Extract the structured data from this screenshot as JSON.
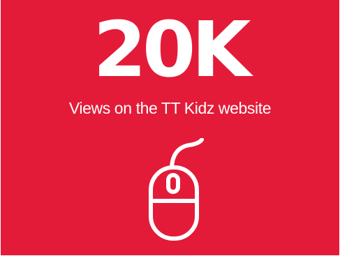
{
  "stat": {
    "value": "20K",
    "caption": "Views on the TT Kidz website"
  },
  "icon": "computer-mouse-icon",
  "colors": {
    "background": "#e31b39",
    "foreground": "#ffffff"
  }
}
